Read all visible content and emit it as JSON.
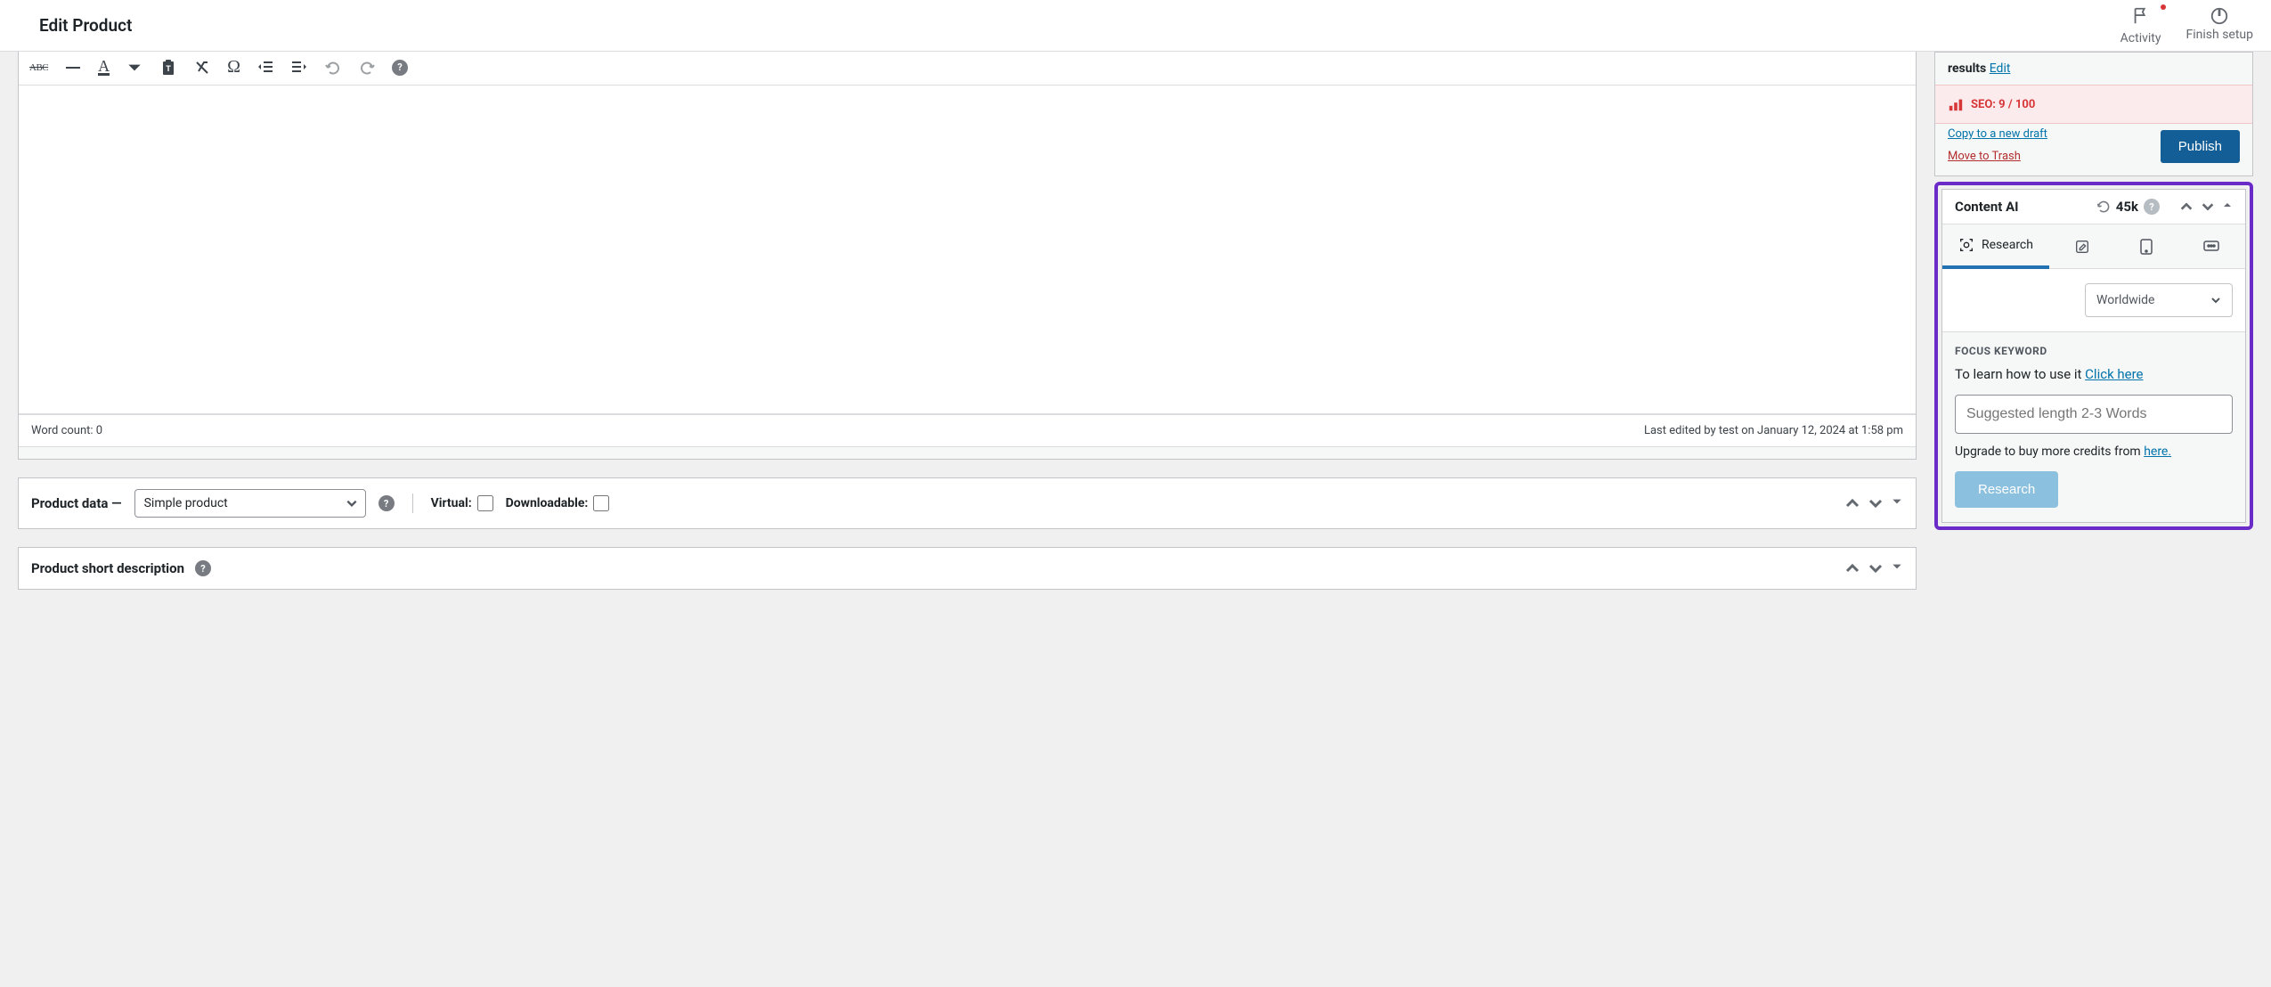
{
  "page": {
    "title": "Edit Product"
  },
  "topbar": {
    "activity": "Activity",
    "finish": "Finish setup"
  },
  "editor": {
    "word_count": "Word count: 0",
    "last_edited": "Last edited by test on January 12, 2024 at 1:58 pm"
  },
  "product_data": {
    "label": "Product data —",
    "select_value": "Simple product",
    "virtual_label": "Virtual:",
    "downloadable_label": "Downloadable:"
  },
  "short_desc": {
    "title": "Product short description"
  },
  "publish": {
    "results_label": "results",
    "edit": "Edit",
    "seo_label": "SEO: 9 / 100",
    "copy_draft": "Copy to a new draft",
    "trash": "Move to Trash",
    "publish_btn": "Publish"
  },
  "content_ai": {
    "title": "Content AI",
    "count": "45k",
    "tabs": {
      "research": "Research"
    },
    "region": {
      "value": "Worldwide"
    },
    "focus_label": "FOCUS KEYWORD",
    "hint_prefix": "To learn how to use it ",
    "hint_link": "Click here",
    "input_placeholder": "Suggested length 2-3 Words",
    "upgrade_prefix": "Upgrade to buy more credits from ",
    "upgrade_link": "here.",
    "research_btn": "Research"
  }
}
